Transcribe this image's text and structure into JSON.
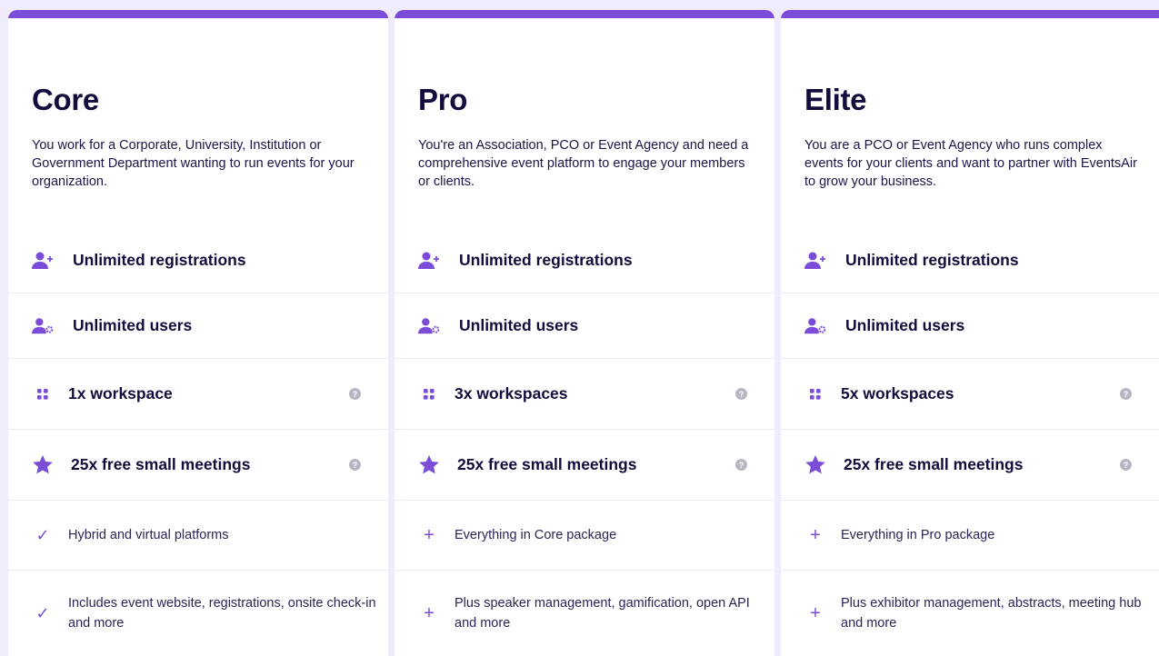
{
  "colors": {
    "accent": "#7a4cd8",
    "background": "#f1ecfb",
    "card": "#ffffff",
    "divider": "#ece8f6",
    "help_icon": "#b9b6c4"
  },
  "plans": [
    {
      "name": "Core",
      "description": "You work for a Corporate, University, Institution or Government Department wanting to run events for your organization.",
      "features": {
        "registrations": "Unlimited registrations",
        "users": "Unlimited users",
        "workspaces": "1x workspace",
        "meetings": "25x free small meetings",
        "item1": "Hybrid and virtual platforms",
        "item2": "Includes event website, registrations, onsite check-in and more"
      },
      "item_icon": "check-icon"
    },
    {
      "name": "Pro",
      "description": "You're an Association, PCO or Event Agency and need a comprehensive event platform to engage your members or clients.",
      "features": {
        "registrations": "Unlimited registrations",
        "users": "Unlimited users",
        "workspaces": "3x workspaces",
        "meetings": "25x free small meetings",
        "item1": "Everything in Core package",
        "item2": "Plus speaker management, gamification, open API and more"
      },
      "item_icon": "plus-icon"
    },
    {
      "name": "Elite",
      "description": "You are a PCO or Event Agency who runs complex events for your clients and want to partner with EventsAir to grow your business.",
      "features": {
        "registrations": "Unlimited registrations",
        "users": "Unlimited users",
        "workspaces": "5x workspaces",
        "meetings": "25x free small meetings",
        "item1": "Everything in Pro package",
        "item2": "Plus exhibitor management, abstracts, meeting hub and more"
      },
      "item_icon": "plus-icon"
    }
  ],
  "help_glyph": "?"
}
